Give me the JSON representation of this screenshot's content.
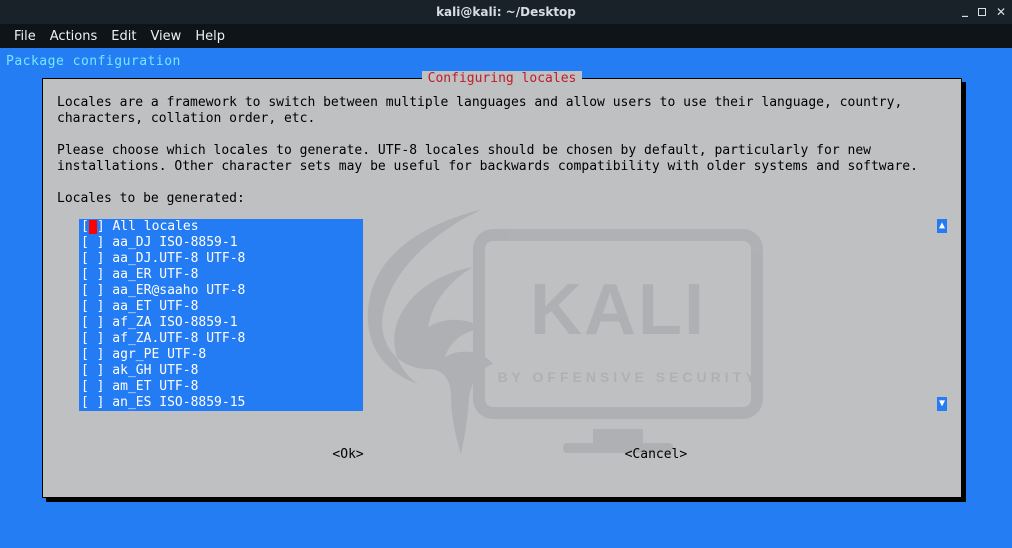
{
  "window": {
    "title": "kali@kali: ~/Desktop"
  },
  "menubar": {
    "file": "File",
    "actions": "Actions",
    "edit": "Edit",
    "view": "View",
    "help": "Help"
  },
  "terminal": {
    "header_line": "Package configuration"
  },
  "dialog": {
    "title": "Configuring locales",
    "para1": "Locales are a framework to switch between multiple languages and allow users to use their language, country, characters, collation order, etc.",
    "para2": "Please choose which locales to generate. UTF-8 locales should be chosen by default, particularly for new installations. Other character sets may be useful for backwards compatibility with older systems and software.",
    "prompt": "Locales to be generated:",
    "ok": "<Ok>",
    "cancel": "<Cancel>",
    "selected_index": 0,
    "locales": [
      {
        "checked": false,
        "label": "All locales"
      },
      {
        "checked": false,
        "label": "aa_DJ ISO-8859-1"
      },
      {
        "checked": false,
        "label": "aa_DJ.UTF-8 UTF-8"
      },
      {
        "checked": false,
        "label": "aa_ER UTF-8"
      },
      {
        "checked": false,
        "label": "aa_ER@saaho UTF-8"
      },
      {
        "checked": false,
        "label": "aa_ET UTF-8"
      },
      {
        "checked": false,
        "label": "af_ZA ISO-8859-1"
      },
      {
        "checked": false,
        "label": "af_ZA.UTF-8 UTF-8"
      },
      {
        "checked": false,
        "label": "agr_PE UTF-8"
      },
      {
        "checked": false,
        "label": "ak_GH UTF-8"
      },
      {
        "checked": false,
        "label": "am_ET UTF-8"
      },
      {
        "checked": false,
        "label": "an_ES ISO-8859-15"
      }
    ]
  },
  "watermark": {
    "brand": "KALI",
    "tagline": "BY OFFENSIVE SECURITY"
  }
}
